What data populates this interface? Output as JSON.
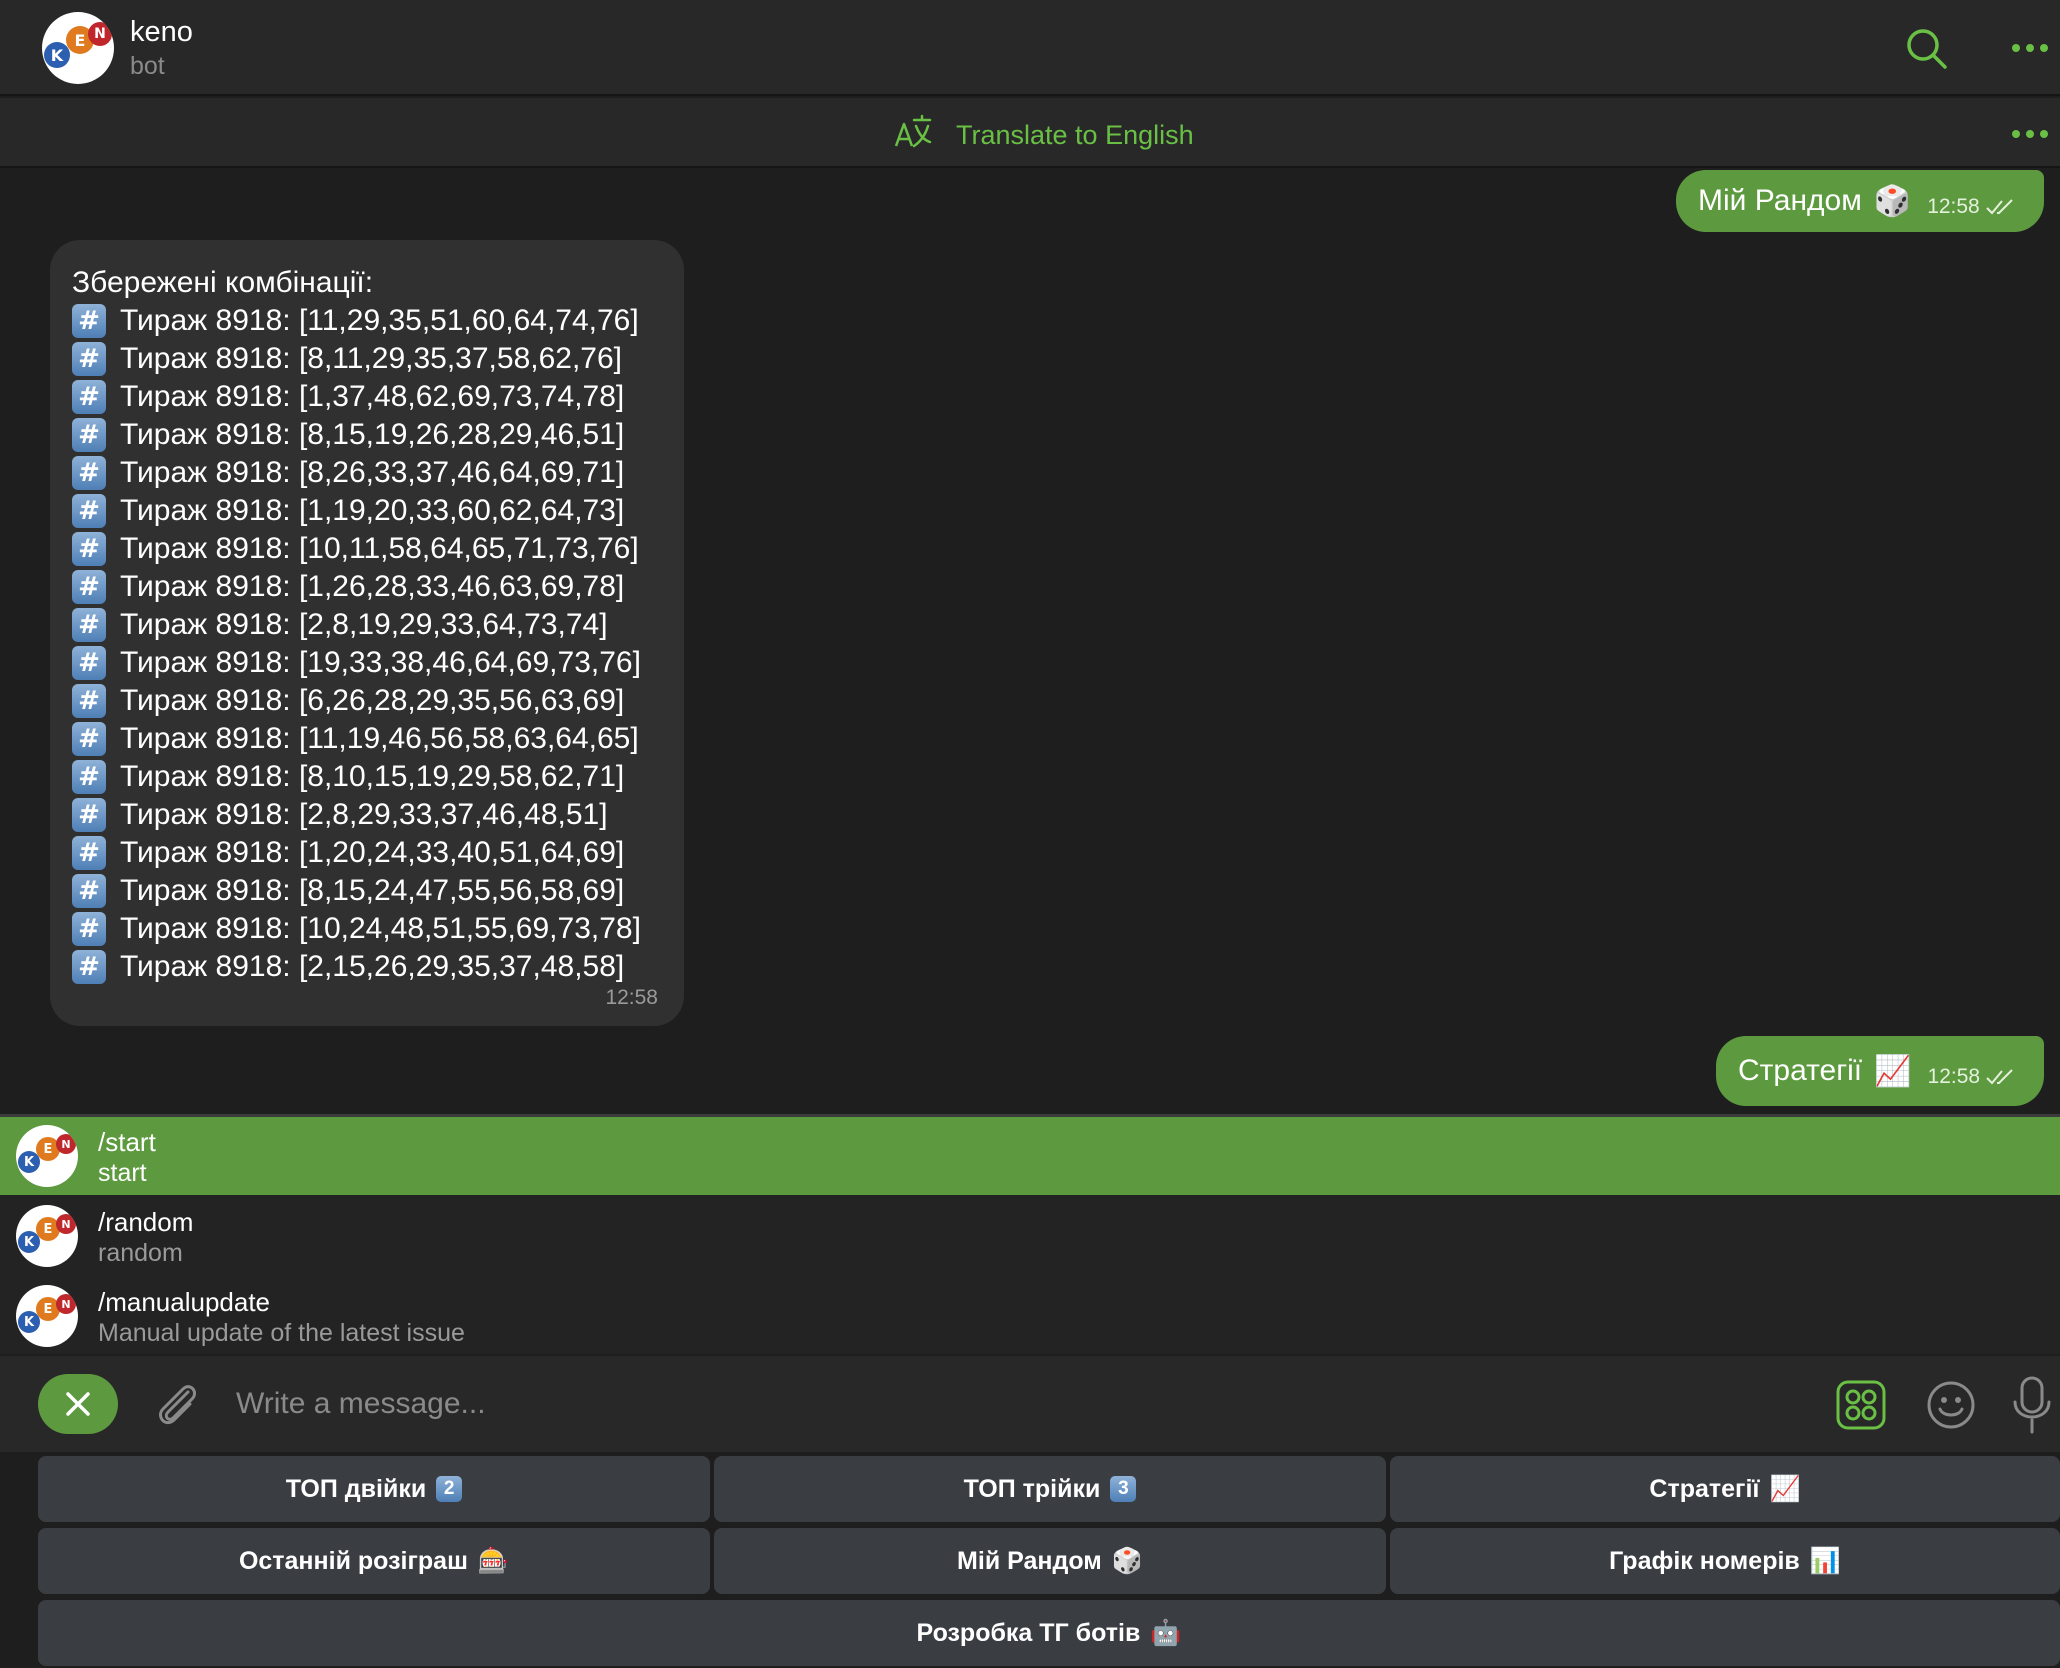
{
  "header": {
    "title": "keno",
    "subtitle": "bot",
    "avatar_letters": [
      "K",
      "E",
      "N"
    ]
  },
  "translate": {
    "label": "Translate to English"
  },
  "messages": {
    "outgoing_1": {
      "text": "Мій Рандом",
      "emoji": "🎲",
      "time": "12:58"
    },
    "incoming": {
      "heading": "Збережені комбінації:",
      "combo_icon": "#",
      "combos": [
        "Тираж 8918: [11,29,35,51,60,64,74,76]",
        "Тираж 8918: [8,11,29,35,37,58,62,76]",
        "Тираж 8918: [1,37,48,62,69,73,74,78]",
        "Тираж 8918: [8,15,19,26,28,29,46,51]",
        "Тираж 8918: [8,26,33,37,46,64,69,71]",
        "Тираж 8918: [1,19,20,33,60,62,64,73]",
        "Тираж 8918: [10,11,58,64,65,71,73,76]",
        "Тираж 8918: [1,26,28,33,46,63,69,78]",
        "Тираж 8918: [2,8,19,29,33,64,73,74]",
        "Тираж 8918: [19,33,38,46,64,69,73,76]",
        "Тираж 8918: [6,26,28,29,35,56,63,69]",
        "Тираж 8918: [11,19,46,56,58,63,64,65]",
        "Тираж 8918: [8,10,15,19,29,58,62,71]",
        "Тираж 8918: [2,8,29,33,37,46,48,51]",
        "Тираж 8918: [1,20,24,33,40,51,64,69]",
        "Тираж 8918: [8,15,24,47,55,56,58,69]",
        "Тираж 8918: [10,24,48,51,55,69,73,78]",
        "Тираж 8918: [2,15,26,29,35,37,48,58]"
      ],
      "time": "12:58"
    },
    "outgoing_2": {
      "text": "Стратегії",
      "emoji": "📈",
      "time": "12:58"
    }
  },
  "commands": [
    {
      "name": "/start",
      "description": "start"
    },
    {
      "name": "/random",
      "description": "random"
    },
    {
      "name": "/manualupdate",
      "description": "Manual update of the latest issue"
    }
  ],
  "input": {
    "placeholder": "Write a message..."
  },
  "keyboard": {
    "rows": [
      [
        {
          "label": "ТОП двійки",
          "badge": "2"
        },
        {
          "label": "ТОП трійки",
          "badge": "3"
        },
        {
          "label": "Стратегії",
          "emoji": "📈"
        }
      ],
      [
        {
          "label": "Останній розіграш",
          "emoji": "🎰"
        },
        {
          "label": "Мій Рандом",
          "emoji": "🎲"
        },
        {
          "label": "Графік номерів",
          "emoji": "📊"
        }
      ],
      [
        {
          "label": "Розробка ТГ ботів",
          "emoji": "🤖"
        }
      ]
    ]
  },
  "colors": {
    "accent": "#6ac045",
    "outgoing_bubble": "#5d9a3f",
    "incoming_bubble": "#303030",
    "background": "#1e1e1e",
    "keyboard_button": "#3a3d42"
  }
}
